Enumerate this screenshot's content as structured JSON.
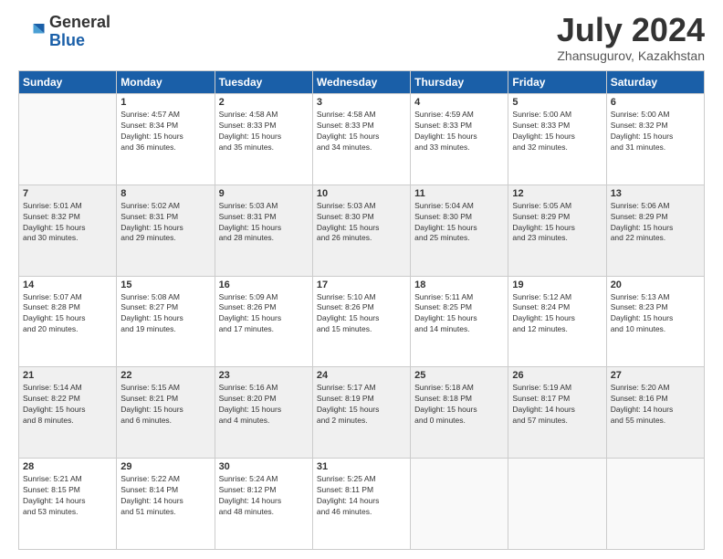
{
  "header": {
    "logo_general": "General",
    "logo_blue": "Blue",
    "month_title": "July 2024",
    "location": "Zhansugurov, Kazakhstan"
  },
  "calendar": {
    "days_of_week": [
      "Sunday",
      "Monday",
      "Tuesday",
      "Wednesday",
      "Thursday",
      "Friday",
      "Saturday"
    ],
    "weeks": [
      [
        {
          "num": "",
          "info": ""
        },
        {
          "num": "1",
          "info": "Sunrise: 4:57 AM\nSunset: 8:34 PM\nDaylight: 15 hours\nand 36 minutes."
        },
        {
          "num": "2",
          "info": "Sunrise: 4:58 AM\nSunset: 8:33 PM\nDaylight: 15 hours\nand 35 minutes."
        },
        {
          "num": "3",
          "info": "Sunrise: 4:58 AM\nSunset: 8:33 PM\nDaylight: 15 hours\nand 34 minutes."
        },
        {
          "num": "4",
          "info": "Sunrise: 4:59 AM\nSunset: 8:33 PM\nDaylight: 15 hours\nand 33 minutes."
        },
        {
          "num": "5",
          "info": "Sunrise: 5:00 AM\nSunset: 8:33 PM\nDaylight: 15 hours\nand 32 minutes."
        },
        {
          "num": "6",
          "info": "Sunrise: 5:00 AM\nSunset: 8:32 PM\nDaylight: 15 hours\nand 31 minutes."
        }
      ],
      [
        {
          "num": "7",
          "info": "Sunrise: 5:01 AM\nSunset: 8:32 PM\nDaylight: 15 hours\nand 30 minutes."
        },
        {
          "num": "8",
          "info": "Sunrise: 5:02 AM\nSunset: 8:31 PM\nDaylight: 15 hours\nand 29 minutes."
        },
        {
          "num": "9",
          "info": "Sunrise: 5:03 AM\nSunset: 8:31 PM\nDaylight: 15 hours\nand 28 minutes."
        },
        {
          "num": "10",
          "info": "Sunrise: 5:03 AM\nSunset: 8:30 PM\nDaylight: 15 hours\nand 26 minutes."
        },
        {
          "num": "11",
          "info": "Sunrise: 5:04 AM\nSunset: 8:30 PM\nDaylight: 15 hours\nand 25 minutes."
        },
        {
          "num": "12",
          "info": "Sunrise: 5:05 AM\nSunset: 8:29 PM\nDaylight: 15 hours\nand 23 minutes."
        },
        {
          "num": "13",
          "info": "Sunrise: 5:06 AM\nSunset: 8:29 PM\nDaylight: 15 hours\nand 22 minutes."
        }
      ],
      [
        {
          "num": "14",
          "info": "Sunrise: 5:07 AM\nSunset: 8:28 PM\nDaylight: 15 hours\nand 20 minutes."
        },
        {
          "num": "15",
          "info": "Sunrise: 5:08 AM\nSunset: 8:27 PM\nDaylight: 15 hours\nand 19 minutes."
        },
        {
          "num": "16",
          "info": "Sunrise: 5:09 AM\nSunset: 8:26 PM\nDaylight: 15 hours\nand 17 minutes."
        },
        {
          "num": "17",
          "info": "Sunrise: 5:10 AM\nSunset: 8:26 PM\nDaylight: 15 hours\nand 15 minutes."
        },
        {
          "num": "18",
          "info": "Sunrise: 5:11 AM\nSunset: 8:25 PM\nDaylight: 15 hours\nand 14 minutes."
        },
        {
          "num": "19",
          "info": "Sunrise: 5:12 AM\nSunset: 8:24 PM\nDaylight: 15 hours\nand 12 minutes."
        },
        {
          "num": "20",
          "info": "Sunrise: 5:13 AM\nSunset: 8:23 PM\nDaylight: 15 hours\nand 10 minutes."
        }
      ],
      [
        {
          "num": "21",
          "info": "Sunrise: 5:14 AM\nSunset: 8:22 PM\nDaylight: 15 hours\nand 8 minutes."
        },
        {
          "num": "22",
          "info": "Sunrise: 5:15 AM\nSunset: 8:21 PM\nDaylight: 15 hours\nand 6 minutes."
        },
        {
          "num": "23",
          "info": "Sunrise: 5:16 AM\nSunset: 8:20 PM\nDaylight: 15 hours\nand 4 minutes."
        },
        {
          "num": "24",
          "info": "Sunrise: 5:17 AM\nSunset: 8:19 PM\nDaylight: 15 hours\nand 2 minutes."
        },
        {
          "num": "25",
          "info": "Sunrise: 5:18 AM\nSunset: 8:18 PM\nDaylight: 15 hours\nand 0 minutes."
        },
        {
          "num": "26",
          "info": "Sunrise: 5:19 AM\nSunset: 8:17 PM\nDaylight: 14 hours\nand 57 minutes."
        },
        {
          "num": "27",
          "info": "Sunrise: 5:20 AM\nSunset: 8:16 PM\nDaylight: 14 hours\nand 55 minutes."
        }
      ],
      [
        {
          "num": "28",
          "info": "Sunrise: 5:21 AM\nSunset: 8:15 PM\nDaylight: 14 hours\nand 53 minutes."
        },
        {
          "num": "29",
          "info": "Sunrise: 5:22 AM\nSunset: 8:14 PM\nDaylight: 14 hours\nand 51 minutes."
        },
        {
          "num": "30",
          "info": "Sunrise: 5:24 AM\nSunset: 8:12 PM\nDaylight: 14 hours\nand 48 minutes."
        },
        {
          "num": "31",
          "info": "Sunrise: 5:25 AM\nSunset: 8:11 PM\nDaylight: 14 hours\nand 46 minutes."
        },
        {
          "num": "",
          "info": ""
        },
        {
          "num": "",
          "info": ""
        },
        {
          "num": "",
          "info": ""
        }
      ]
    ]
  }
}
